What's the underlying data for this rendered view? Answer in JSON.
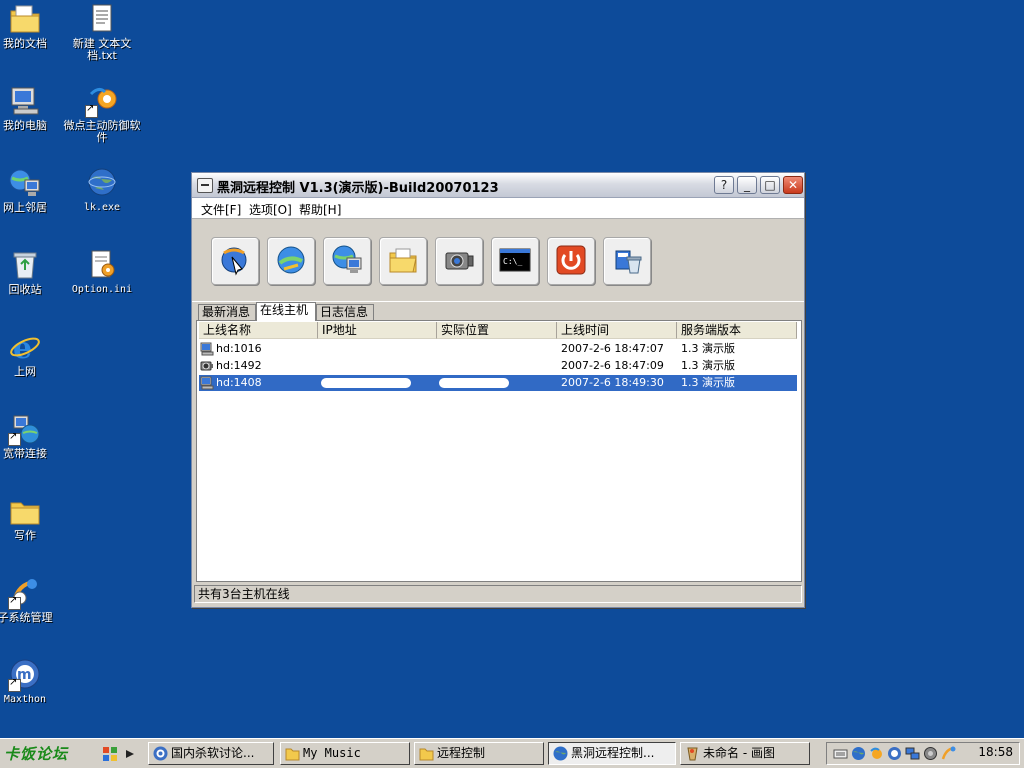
{
  "desktop": {
    "icons": [
      {
        "label": "我的文档",
        "icon": "my-documents-folder-icon"
      },
      {
        "label": "新建 文本文档.txt",
        "icon": "text-file-icon"
      },
      {
        "label": "我的电脑",
        "icon": "my-computer-icon"
      },
      {
        "label": "微点主动防御软件",
        "icon": "antivirus-shortcut-icon"
      },
      {
        "label": "网上邻居",
        "icon": "network-places-icon"
      },
      {
        "label": "lk.exe",
        "icon": "globe-exe-icon"
      },
      {
        "label": "回收站",
        "icon": "recycle-bin-icon"
      },
      {
        "label": "Option.ini",
        "icon": "ini-file-icon"
      },
      {
        "label": "上网",
        "icon": "internet-explorer-icon"
      },
      {
        "label": "宽带连接",
        "icon": "broadband-connection-icon"
      },
      {
        "label": "写作",
        "icon": "folder-icon"
      },
      {
        "label": "子系统管理",
        "icon": "subsystem-manager-icon"
      },
      {
        "label": "Maxthon",
        "icon": "maxthon-icon"
      }
    ]
  },
  "window": {
    "title": "黑洞远程控制 V1.3(演示版)-Build20070123",
    "buttons": {
      "help": "?",
      "min": "_",
      "max": "□",
      "close": "✕"
    },
    "menu": [
      "文件[F]",
      "选项[O]",
      "帮助[H]"
    ],
    "toolbar": [
      "monitor-target-icon",
      "screen-control-icon",
      "computer-network-icon",
      "file-folder-icon",
      "camera-icon",
      "cmd-terminal-icon",
      "power-shutdown-icon",
      "uninstall-delete-icon"
    ],
    "tabs": [
      "最新消息",
      "在线主机",
      "日志信息"
    ],
    "active_tab": 1,
    "columns": [
      "上线名称",
      "IP地址",
      "实际位置",
      "上线时间",
      "服务端版本"
    ],
    "rows": [
      {
        "name": "hd:1016",
        "time": "2007-2-6 18:47:07",
        "version": "1.3 演示版",
        "selected": false
      },
      {
        "name": "hd:1492",
        "time": "2007-2-6 18:47:09",
        "version": "1.3 演示版",
        "selected": false
      },
      {
        "name": "hd:1408",
        "time": "2007-2-6 18:49:30",
        "version": "1.3 演示版",
        "selected": true
      }
    ],
    "status": "共有3台主机在线"
  },
  "taskbar": {
    "start_logo": "卡饭论坛",
    "tasks": [
      {
        "label": "国内杀软讨论...",
        "icon": "maxthon-icon",
        "active": false
      },
      {
        "label": "My Music",
        "icon": "folder-icon",
        "active": false
      },
      {
        "label": "远程控制",
        "icon": "folder-icon",
        "active": false
      },
      {
        "label": "黑洞远程控制...",
        "icon": "globe-icon",
        "active": true
      },
      {
        "label": "未命名 - 画图",
        "icon": "paint-icon",
        "active": false
      }
    ],
    "clock": "18:58"
  },
  "colors": {
    "desktop": "#0d4b9a",
    "selection": "#316ac5",
    "window_face": "#d4d0c8"
  }
}
